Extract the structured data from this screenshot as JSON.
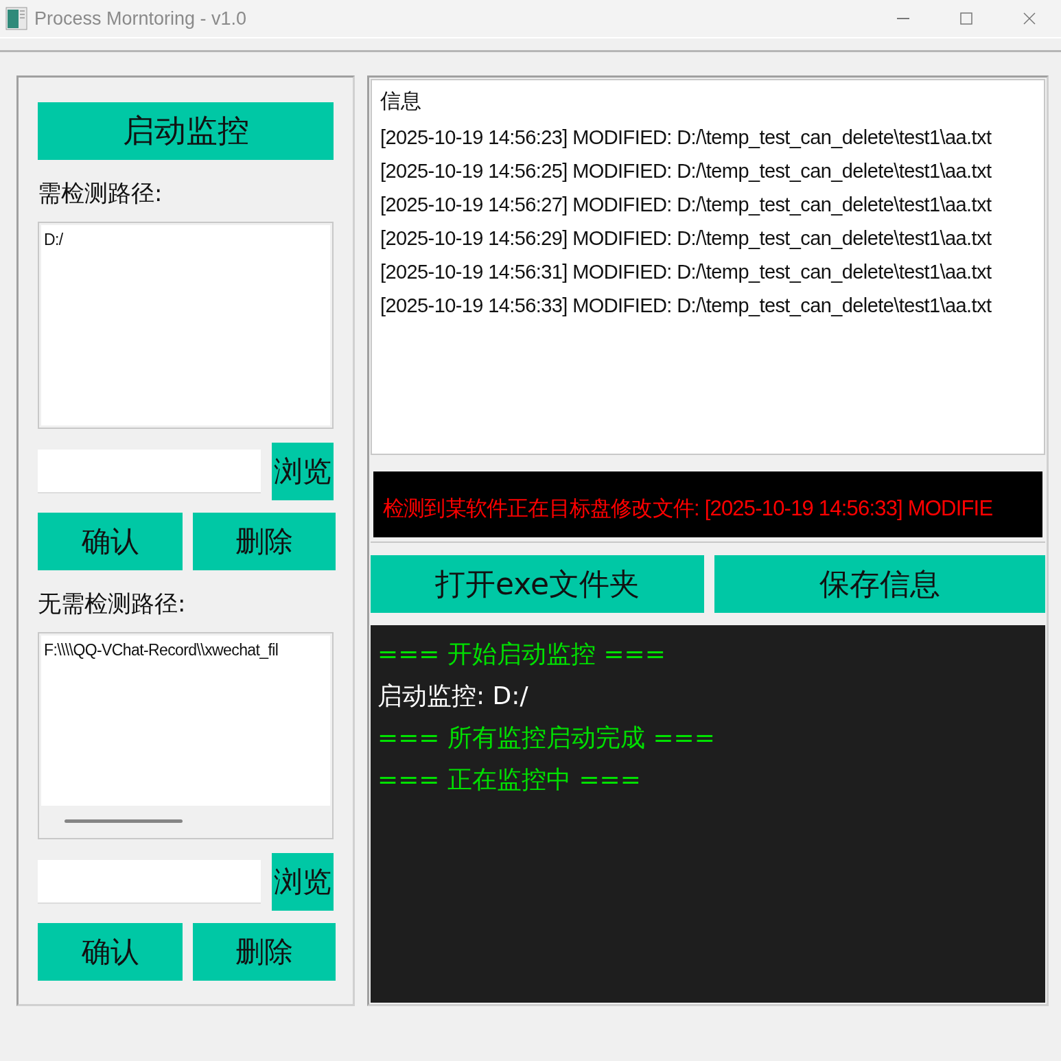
{
  "window": {
    "title": "Process Morntoring - v1.0"
  },
  "left_panel": {
    "start_button": "启动监控",
    "sections": [
      {
        "label": "需检测路径:",
        "paths": [
          "D:/"
        ],
        "h_scrollbar": false,
        "browse_button": "浏览",
        "confirm_button": "确认",
        "delete_button": "删除"
      },
      {
        "label": "无需检测路径:",
        "paths": [
          "F:\\\\\\\\QQ-VChat-Record\\\\xwechat_fil"
        ],
        "h_scrollbar": true,
        "browse_button": "浏览",
        "confirm_button": "确认",
        "delete_button": "删除"
      }
    ]
  },
  "right_panel": {
    "info_list": {
      "header": "信息",
      "entries": [
        "[2025-10-19 14:56:23] MODIFIED: D:/\\temp_test_can_delete\\test1\\aa.txt",
        "[2025-10-19 14:56:25] MODIFIED: D:/\\temp_test_can_delete\\test1\\aa.txt",
        "[2025-10-19 14:56:27] MODIFIED: D:/\\temp_test_can_delete\\test1\\aa.txt",
        "[2025-10-19 14:56:29] MODIFIED: D:/\\temp_test_can_delete\\test1\\aa.txt",
        "[2025-10-19 14:56:31] MODIFIED: D:/\\temp_test_can_delete\\test1\\aa.txt",
        "[2025-10-19 14:56:33] MODIFIED: D:/\\temp_test_can_delete\\test1\\aa.txt"
      ]
    },
    "alert": "检测到某软件正在目标盘修改文件: [2025-10-19 14:56:33] MODIFIE",
    "buttons": [
      "打开exe文件夹",
      "保存信息"
    ],
    "console": [
      {
        "kind": "banner",
        "text": "=== 开始启动监控 ==="
      },
      {
        "kind": "plain",
        "text": "启动监控: D:/"
      },
      {
        "kind": "banner",
        "text": "=== 所有监控启动完成 ==="
      },
      {
        "kind": "banner",
        "text": "=== 正在监控中 ==="
      }
    ]
  }
}
